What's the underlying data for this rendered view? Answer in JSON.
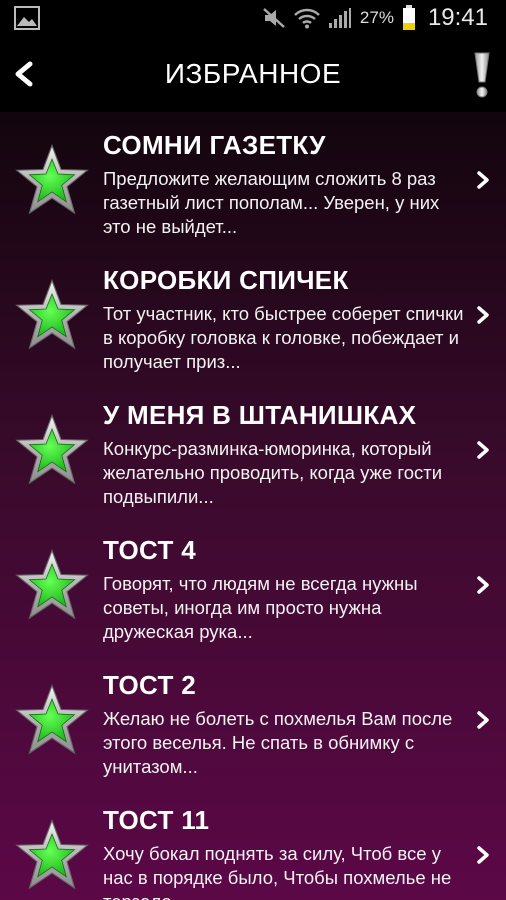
{
  "status_bar": {
    "battery_percent": "27%",
    "time": "19:41"
  },
  "header": {
    "title": "ИЗБРАННОЕ"
  },
  "items": [
    {
      "title": "СОМНИ ГАЗЕТКУ",
      "description": "Предложите желающим сложить 8 раз газетный лист пополам... Уверен, у них это не выйдет..."
    },
    {
      "title": "КОРОБКИ СПИЧЕК",
      "description": "Тот участник, кто быстрее соберет спички в коробку головка к головке, побеждает и получает приз..."
    },
    {
      "title": "У МЕНЯ В ШТАНИШКАХ",
      "description": "Конкурс-разминка-юморинка, который желательно проводить, когда уже гости подвыпили..."
    },
    {
      "title": "ТОСТ 4",
      "description": "Говорят, что людям не всегда нужны советы, иногда им просто нужна дружеская рука..."
    },
    {
      "title": "ТОСТ 2",
      "description": "Желаю не болеть с похмелья Вам после этого веселья. Не спать в обнимку с унитазом..."
    },
    {
      "title": "ТОСТ 11",
      "description": "Хочу бокал поднять за силу, Чтоб все у нас в порядке было, Чтобы похмелье не терзало..."
    }
  ],
  "icons": {
    "star": "star-icon",
    "chevron": "chevron-right-icon",
    "back": "back-arrow-icon",
    "info": "exclamation-icon"
  },
  "colors": {
    "star_fill": "#33cc33",
    "star_border": "#c8c8c8",
    "bg_top": "#12050d",
    "bg_bottom": "#5c0847"
  }
}
